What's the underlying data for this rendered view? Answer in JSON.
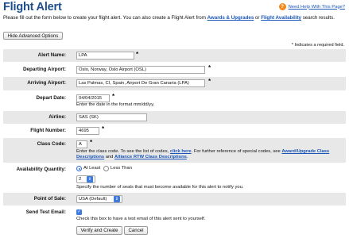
{
  "header": {
    "title": "Flight Alert",
    "help_link": "Need Help With This Page?",
    "help_icon": "?"
  },
  "intro": {
    "text_before": "Please fill out the form below to create your flight alert. You can also create a Flight Alert from ",
    "link1": "Awards & Upgrades",
    "text_mid": " or ",
    "link2": "Flight Availability",
    "text_after": " search results."
  },
  "buttons": {
    "hide_advanced": "Hide Advanced Options",
    "verify": "Verify and Create",
    "cancel": "Cancel"
  },
  "required_note": "* Indicates a required field.",
  "form": {
    "alert_name": {
      "label": "Alert Name:",
      "value": "LPA"
    },
    "departing_airport": {
      "label": "Departing Airport:",
      "value": "Oslo, Norway, Oslo Airport (OSL)"
    },
    "arriving_airport": {
      "label": "Arriving Airport:",
      "value": "Las Palmas, CI, Spain, Airport De Gran Canaria (LPA)"
    },
    "depart_date": {
      "label": "Depart Date:",
      "value": "04/04/2015",
      "note": "Enter the date in the format mm/dd/yy."
    },
    "airline": {
      "label": "Airline:",
      "value": "SAS (SK)"
    },
    "flight_number": {
      "label": "Flight Number:",
      "value": "4695"
    },
    "class_code": {
      "label": "Class Code:",
      "value": "A",
      "note_1": "Enter the class code. To see the list of codes, ",
      "link_1": "click here",
      "note_2": ". For further reference of special codes, see ",
      "link_2": "Award/Upgrade Class Descriptions",
      "note_3": " and ",
      "link_3": "Alliance RTW Class Descriptions",
      "note_4": "."
    },
    "availability_quantity": {
      "label": "Availability Quantity:",
      "option_at_least": "At Least",
      "option_less_than": "Less Than",
      "selected": "At Least",
      "quantity": "2",
      "note": "Specify the number of seats that must become available for this alert to notify you."
    },
    "point_of_sale": {
      "label": "Point of Sale:",
      "value": "USA (Default)"
    },
    "send_test_email": {
      "label": "Send Test Email:",
      "checked": true,
      "note": "Check this box to have a test email of this alert sent to yourself."
    }
  },
  "colors": {
    "title": "#1f4e8c",
    "link": "#1a56b8",
    "help_icon": "#f08a1c",
    "shaded_row": "#e8e8e8",
    "control_blue": "#3c7be0"
  },
  "icons": {
    "help": "question-circle-icon",
    "select_arrow": "updown-arrow-icon",
    "checkbox": "checkmark-icon"
  }
}
